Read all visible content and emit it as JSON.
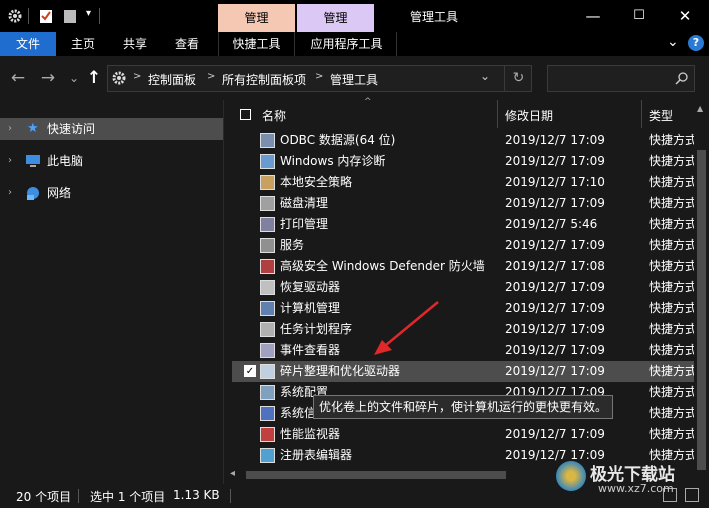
{
  "titlebar": {
    "context_tab_1": "管理",
    "context_tab_2": "管理",
    "window_title": "管理工具",
    "minimize": "—",
    "maximize": "☐",
    "close": "✕"
  },
  "ribbon": {
    "file": "文件",
    "home": "主页",
    "share": "共享",
    "view": "查看",
    "shortcut_tools": "快捷工具",
    "app_tools": "应用程序工具",
    "expand": "⌄",
    "help": "?"
  },
  "nav": {
    "back": "←",
    "forward": "→",
    "recent": "⌄",
    "up": "↑",
    "breadcrumb": [
      "控制面板",
      "所有控制面板项",
      "管理工具"
    ],
    "separator": ">",
    "dropdown": "⌄",
    "refresh": "↻",
    "search_placeholder": ""
  },
  "sidebar": {
    "items": [
      {
        "label": "快速访问",
        "icon": "star-icon",
        "selected": true
      },
      {
        "label": "此电脑",
        "icon": "computer-icon",
        "selected": false
      },
      {
        "label": "网络",
        "icon": "network-icon",
        "selected": false
      }
    ]
  },
  "columns": {
    "name": "名称",
    "date": "修改日期",
    "type": "类型"
  },
  "files": [
    {
      "name": "ODBC 数据源(64 位)",
      "date": "2019/12/7 17:09",
      "type": "快捷方式"
    },
    {
      "name": "Windows 内存诊断",
      "date": "2019/12/7 17:09",
      "type": "快捷方式"
    },
    {
      "name": "本地安全策略",
      "date": "2019/12/7 17:10",
      "type": "快捷方式"
    },
    {
      "name": "磁盘清理",
      "date": "2019/12/7 17:09",
      "type": "快捷方式"
    },
    {
      "name": "打印管理",
      "date": "2019/12/7 5:46",
      "type": "快捷方式"
    },
    {
      "name": "服务",
      "date": "2019/12/7 17:09",
      "type": "快捷方式"
    },
    {
      "name": "高级安全 Windows Defender 防火墙",
      "date": "2019/12/7 17:08",
      "type": "快捷方式"
    },
    {
      "name": "恢复驱动器",
      "date": "2019/12/7 17:09",
      "type": "快捷方式"
    },
    {
      "name": "计算机管理",
      "date": "2019/12/7 17:09",
      "type": "快捷方式"
    },
    {
      "name": "任务计划程序",
      "date": "2019/12/7 17:09",
      "type": "快捷方式"
    },
    {
      "name": "事件查看器",
      "date": "2019/12/7 17:09",
      "type": "快捷方式"
    },
    {
      "name": "碎片整理和优化驱动器",
      "date": "2019/12/7 17:09",
      "type": "快捷方式",
      "selected": true
    },
    {
      "name": "系统配置",
      "date": "2019/12/7 17:09",
      "type": "快捷方式"
    },
    {
      "name": "系统信息",
      "date": "2019/12/7 17:09",
      "type": "快捷方式"
    },
    {
      "name": "性能监视器",
      "date": "2019/12/7 17:09",
      "type": "快捷方式"
    },
    {
      "name": "注册表编辑器",
      "date": "2019/12/7 17:09",
      "type": "快捷方式"
    }
  ],
  "tooltip": "优化卷上的文件和碎片，使计算机运行的更快更有效。",
  "status": {
    "item_count": "20 个项目",
    "selected": "选中 1 个项目",
    "size": "1.13 KB"
  },
  "watermark": "极光下载站",
  "watermark_url": "www.xz7.com",
  "colors": {
    "context_tab_shortcut": "#f4c8b2",
    "context_tab_app": "#dcc8f4",
    "file_tab": "#1f6ecf",
    "selection": "#4d4d4d",
    "arrow": "#e0282a"
  }
}
